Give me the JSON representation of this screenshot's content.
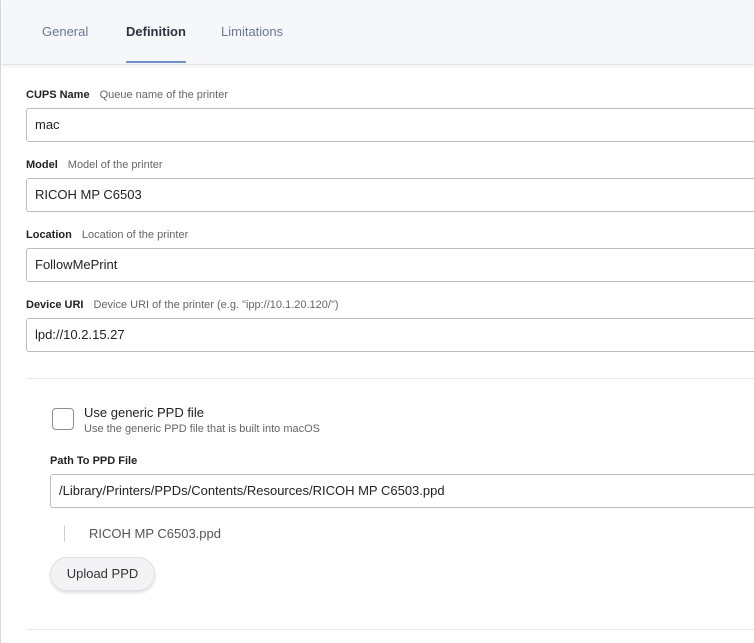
{
  "tabs": [
    {
      "label": "General",
      "active": false
    },
    {
      "label": "Definition",
      "active": true
    },
    {
      "label": "Limitations",
      "active": false
    }
  ],
  "fields": {
    "cups_name": {
      "label": "CUPS Name",
      "help": "Queue name of the printer",
      "value": "mac"
    },
    "model": {
      "label": "Model",
      "help": "Model of the printer",
      "value": "RICOH MP C6503"
    },
    "location": {
      "label": "Location",
      "help": "Location of the printer",
      "value": "FollowMePrint"
    },
    "device_uri": {
      "label": "Device URI",
      "help": "Device URI of the printer (e.g. \"ipp://10.1.20.120/\")",
      "value": "lpd://10.2.15.27"
    }
  },
  "ppd": {
    "generic_label": "Use generic PPD file",
    "generic_help": "Use the generic PPD file that is built into macOS",
    "generic_checked": false,
    "path_label": "Path To PPD File",
    "path_value": "/Library/Printers/PPDs/Contents/Resources/RICOH MP C6503.ppd",
    "file_name": "RICOH MP C6503.ppd",
    "upload_label": "Upload PPD"
  },
  "colors": {
    "accent": "#6f93c8",
    "tab_text": "#6a7892"
  }
}
